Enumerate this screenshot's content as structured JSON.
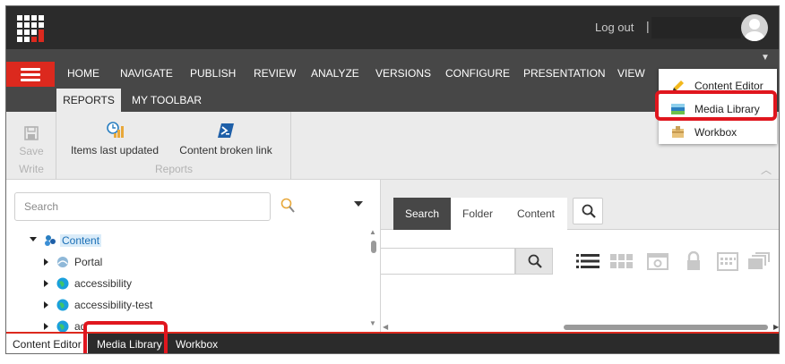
{
  "topbar": {
    "logout": "Log out",
    "separator": "|"
  },
  "nav": {
    "tabs": [
      "HOME",
      "NAVIGATE",
      "PUBLISH",
      "REVIEW",
      "ANALYZE",
      "VERSIONS",
      "CONFIGURE",
      "PRESENTATION",
      "VIEW"
    ],
    "subtabs": {
      "reports": "REPORTS",
      "my_toolbar": "MY TOOLBAR"
    }
  },
  "ribbon": {
    "save": "Save",
    "write": "Write",
    "items_last_updated": "Items last updated",
    "content_broken_link": "Content broken link",
    "reports": "Reports"
  },
  "tree": {
    "search_placeholder": "Search",
    "items": [
      {
        "label": "Content",
        "expanded": true,
        "level": 0,
        "icon": "content-icon"
      },
      {
        "label": "Portal",
        "expanded": false,
        "level": 1,
        "icon": "portal-icon"
      },
      {
        "label": "accessibility",
        "expanded": false,
        "level": 1,
        "icon": "globe-icon"
      },
      {
        "label": "accessibility-test",
        "expanded": false,
        "level": 1,
        "icon": "globe-icon"
      },
      {
        "label": "ad",
        "expanded": false,
        "level": 1,
        "icon": "globe-icon"
      }
    ]
  },
  "media": {
    "tabs": {
      "search": "Search",
      "folder": "Folder",
      "content": "Content"
    }
  },
  "taskbar": {
    "content_editor": "Content Editor",
    "media_library": "Media Library",
    "workbox": "Workbox"
  },
  "menu": {
    "items": [
      {
        "label": "Content Editor",
        "icon": "pencil-icon"
      },
      {
        "label": "Media Library",
        "icon": "media-library-icon"
      },
      {
        "label": "Workbox",
        "icon": "workbox-icon"
      }
    ]
  },
  "colors": {
    "accent": "#dc291e",
    "topbar": "#2b2b2b",
    "nav": "#474747",
    "ribbon": "#ebebeb",
    "highlight": "#e0161e"
  }
}
